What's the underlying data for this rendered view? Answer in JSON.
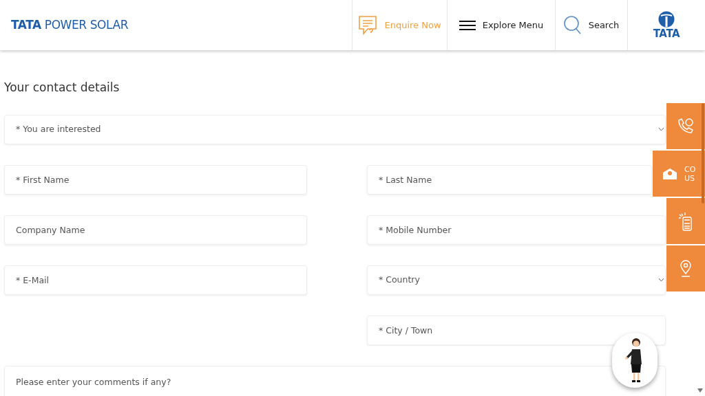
{
  "header": {
    "logo": "**TATA** POWER SOLAR",
    "nav": [
      {
        "kind": "enquire",
        "label": "Enquire Now"
      },
      {
        "kind": "menu",
        "label": "Explore Menu"
      },
      {
        "kind": "search",
        "label": "Search"
      }
    ],
    "brand": "TATA"
  },
  "form": {
    "heading": "Your contact details",
    "rows": [
      {
        "full": {
          "kind": "select",
          "placeholder": "* You are interested"
        }
      },
      {
        "left": {
          "kind": "input",
          "placeholder": "* First Name"
        },
        "right": {
          "kind": "input",
          "placeholder": "* Last Name"
        }
      },
      {
        "left": {
          "kind": "input",
          "placeholder": "Company Name"
        },
        "right": {
          "kind": "input",
          "placeholder": "* Mobile Number"
        }
      },
      {
        "left": {
          "kind": "input",
          "placeholder": "* E-Mail"
        },
        "right": {
          "kind": "select",
          "placeholder": "* Country"
        }
      },
      {
        "right": {
          "kind": "input",
          "placeholder": "* City / Town"
        }
      },
      {
        "full": {
          "kind": "textarea",
          "placeholder": "Please enter your comments if any?"
        }
      }
    ]
  },
  "side_tabs": [
    {
      "kind": "phone",
      "expanded": false
    },
    {
      "kind": "mail",
      "expanded": true,
      "label_lines": [
        "CO",
        "US"
      ]
    },
    {
      "kind": "calculator",
      "expanded": false
    },
    {
      "kind": "location",
      "expanded": false
    }
  ]
}
